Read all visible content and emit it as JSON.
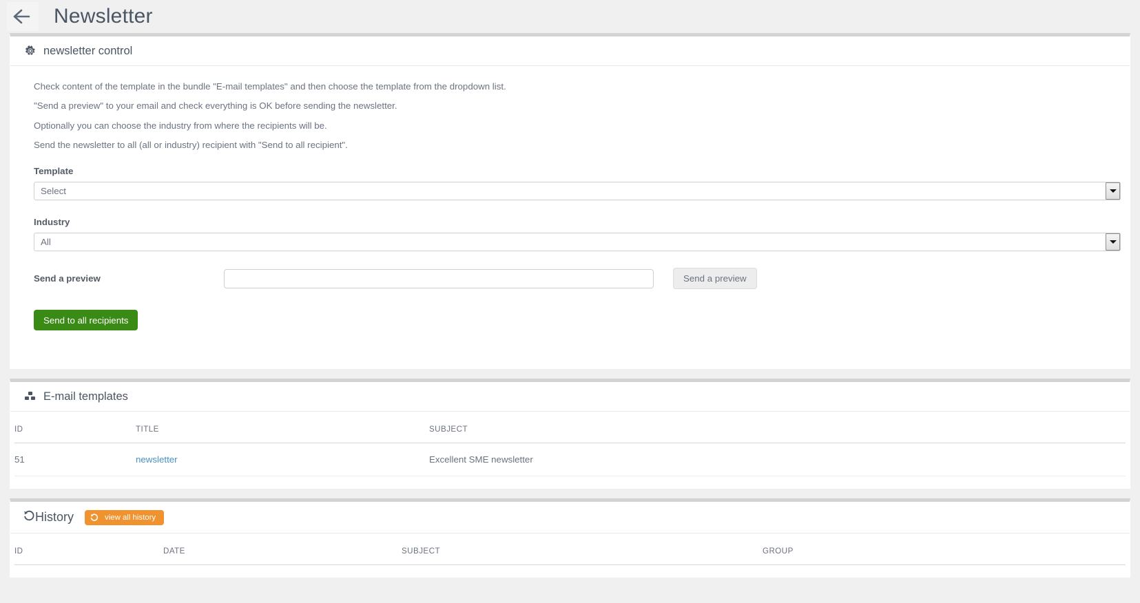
{
  "header": {
    "title": "Newsletter",
    "back_icon": "arrow-left-icon"
  },
  "newsletter_control": {
    "icon": "gear-icon",
    "title": "newsletter control",
    "instructions": [
      "Check content of the template in the bundle \"E-mail templates\" and then choose the template from the dropdown list.",
      "\"Send a preview\" to your email and check everything is OK before sending the newsletter.",
      "Optionally you can choose the industry from where the recipients will be.",
      "Send the newsletter to all (all or industry) recipient with \"Send to all recipient\"."
    ],
    "template": {
      "label": "Template",
      "value": "Select",
      "arrow_icon": "chevron-down-icon"
    },
    "industry": {
      "label": "Industry",
      "value": "All",
      "arrow_icon": "chevron-down-icon"
    },
    "preview": {
      "label": "Send a preview",
      "input_value": "",
      "input_placeholder": "",
      "button_label": "Send a preview"
    },
    "send_all_button": "Send to all recipients"
  },
  "email_templates": {
    "icon": "cubes-icon",
    "title": "E-mail templates",
    "columns": [
      "ID",
      "TITLE",
      "SUBJECT"
    ],
    "rows": [
      {
        "id": "51",
        "title": "newsletter",
        "subject": "Excellent SME newsletter"
      }
    ]
  },
  "history": {
    "icon": "history-icon",
    "title": "History",
    "view_all_button": {
      "icon": "history-icon",
      "label": "view all history"
    },
    "columns": [
      "ID",
      "DATE",
      "SUBJECT",
      "GROUP"
    ],
    "rows": []
  },
  "colors": {
    "page_background": "#f0f0f0",
    "panel_border_top": "#d3d3d3",
    "primary_green": "#3a8a16",
    "accent_orange": "#f0932e",
    "link_blue": "#4a90c4",
    "text_gray": "#6b7280"
  }
}
